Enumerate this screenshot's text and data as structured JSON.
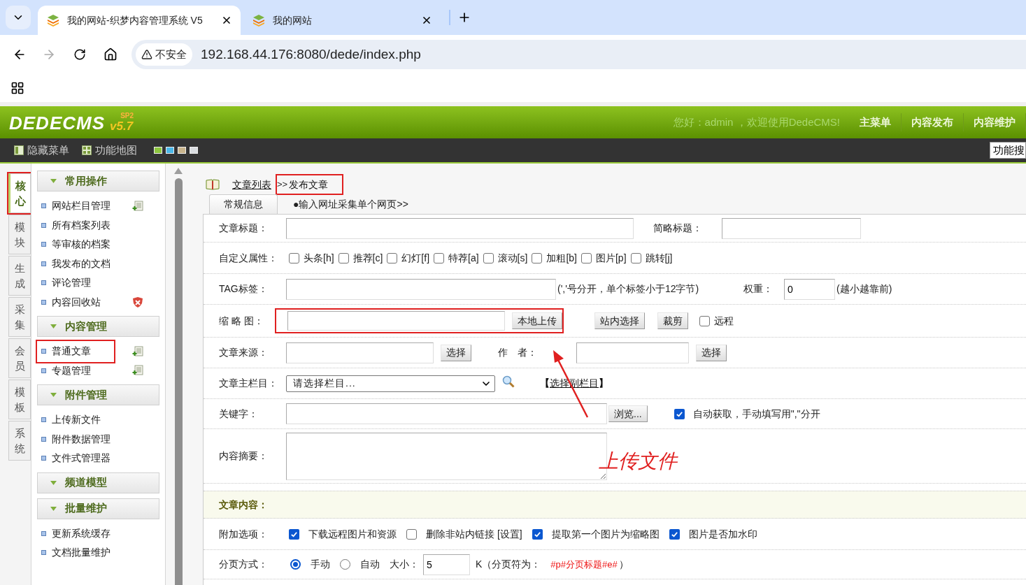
{
  "browser": {
    "tabs": [
      {
        "title": "我的网站-织梦内容管理系统 V5",
        "selected": true
      },
      {
        "title": "我的网站",
        "selected": false
      }
    ],
    "security": "不安全",
    "url": "192.168.44.176:8080/dede/index.php"
  },
  "header": {
    "logo": "DEDECMS",
    "version": "v5.7",
    "edition": "SP2",
    "greeting": "您好：admin ，欢迎使用DedeCMS!",
    "nav": [
      "主菜单",
      "内容发布",
      "内容维护"
    ]
  },
  "toolbar": {
    "items": [
      {
        "label": "隐藏菜单",
        "kind": "panel"
      },
      {
        "label": "功能地图",
        "kind": "grid"
      }
    ],
    "skins": [
      {
        "color": "#8dc63f"
      },
      {
        "color": "#4cb8e8"
      },
      {
        "color": "#c8b48c"
      },
      {
        "color": "#d9dcdf"
      }
    ],
    "search_button": "功能搜"
  },
  "side_tabs": [
    {
      "label": "核心",
      "selected": true,
      "highlighted": true
    },
    {
      "label": "模块",
      "selected": false,
      "highlighted": false
    },
    {
      "label": "生成",
      "selected": false,
      "highlighted": false
    },
    {
      "label": "采集",
      "selected": false,
      "highlighted": false
    },
    {
      "label": "会员",
      "selected": false,
      "highlighted": false
    },
    {
      "label": "模板",
      "selected": false,
      "highlighted": false
    },
    {
      "label": "系统",
      "selected": false,
      "highlighted": false
    }
  ],
  "menu": [
    {
      "title": "常用操作",
      "items": [
        {
          "label": "网站栏目管理",
          "kind": "add",
          "highlighted": false
        },
        {
          "label": "所有档案列表",
          "highlighted": false
        },
        {
          "label": "等审核的档案",
          "highlighted": false
        },
        {
          "label": "我发布的文档",
          "highlighted": false
        },
        {
          "label": "评论管理",
          "highlighted": false
        },
        {
          "label": "内容回收站",
          "kind": "delete",
          "highlighted": false
        }
      ]
    },
    {
      "title": "内容管理",
      "items": [
        {
          "label": "普通文章",
          "kind": "add",
          "highlighted": true
        },
        {
          "label": "专题管理",
          "kind": "add",
          "highlighted": false
        }
      ]
    },
    {
      "title": "附件管理",
      "items": [
        {
          "label": "上传新文件",
          "highlighted": false
        },
        {
          "label": "附件数据管理",
          "highlighted": false
        },
        {
          "label": "文件式管理器",
          "highlighted": false
        }
      ]
    },
    {
      "title": "频道模型"
    },
    {
      "title": "批量维护",
      "items": [
        {
          "label": "更新系统缓存",
          "highlighted": false
        },
        {
          "label": "文档批量维护",
          "highlighted": false
        }
      ]
    }
  ],
  "breadcrumb": {
    "link": "文章列表",
    "separator": ">>",
    "current": "发布文章",
    "highlighted": true
  },
  "form_tabs": [
    {
      "label": "常规信息",
      "selected": true
    },
    {
      "label": "●输入网址采集单个网页>>",
      "selected": false
    }
  ],
  "form": {
    "title_row": {
      "label": "文章标题：",
      "short_title_label": "简略标题："
    },
    "attributes": {
      "label": "自定义属性：",
      "options": [
        {
          "label": "头条[h]",
          "checked": false
        },
        {
          "label": "推荐[c]",
          "checked": false
        },
        {
          "label": "幻灯[f]",
          "checked": false
        },
        {
          "label": "特荐[a]",
          "checked": false
        },
        {
          "label": "滚动[s]",
          "checked": false
        },
        {
          "label": "加粗[b]",
          "checked": false
        },
        {
          "label": "图片[p]",
          "checked": false
        },
        {
          "label": "跳转[j]",
          "checked": false
        }
      ]
    },
    "tags": {
      "label": "TAG标签：",
      "hint": "(','号分开，单个标签小于12字节)",
      "weight_label": "权重：",
      "weight": "0",
      "weight_hint": "(越小越靠前)"
    },
    "thumbnail": {
      "label": "缩 略 图：",
      "upload_button": "本地上传",
      "highlighted": true,
      "buttons": [
        "站内选择",
        "裁剪"
      ],
      "remote": {
        "label": "远程",
        "checked": false
      }
    },
    "source": {
      "label": "文章来源：",
      "button": "选择",
      "author_label": "作　者：",
      "author_button": "选择"
    },
    "column": {
      "label": "文章主栏目：",
      "select": "请选择栏目...",
      "sub_open": "【",
      "sub_link": "选择副栏目",
      "sub_close": "】"
    },
    "keywords": {
      "label": "关键字：",
      "button": "浏览...",
      "auto": {
        "label": "自动获取，手动填写用\",\"分开",
        "checked": true
      }
    },
    "summary": {
      "label": "内容摘要："
    },
    "content_section": {
      "title": "文章内容："
    },
    "options": {
      "label": "附加选项：",
      "items": [
        {
          "label": "下载远程图片和资源",
          "checked": true
        },
        {
          "label": "删除非站内链接 [设置]",
          "checked": false
        },
        {
          "label": "提取第一个图片为缩略图",
          "checked": true
        },
        {
          "label": "图片是否加水印",
          "checked": true
        }
      ]
    },
    "paging": {
      "label": "分页方式：",
      "modes": [
        {
          "label": "手动",
          "selected": true
        },
        {
          "label": "自动",
          "selected": false
        }
      ],
      "size_label": "大小：",
      "size": "5",
      "unit": "K（分页符为：",
      "marker": "#p#分页标题#e#",
      "close": "）"
    }
  },
  "annotation": {
    "text": "上传文件"
  }
}
